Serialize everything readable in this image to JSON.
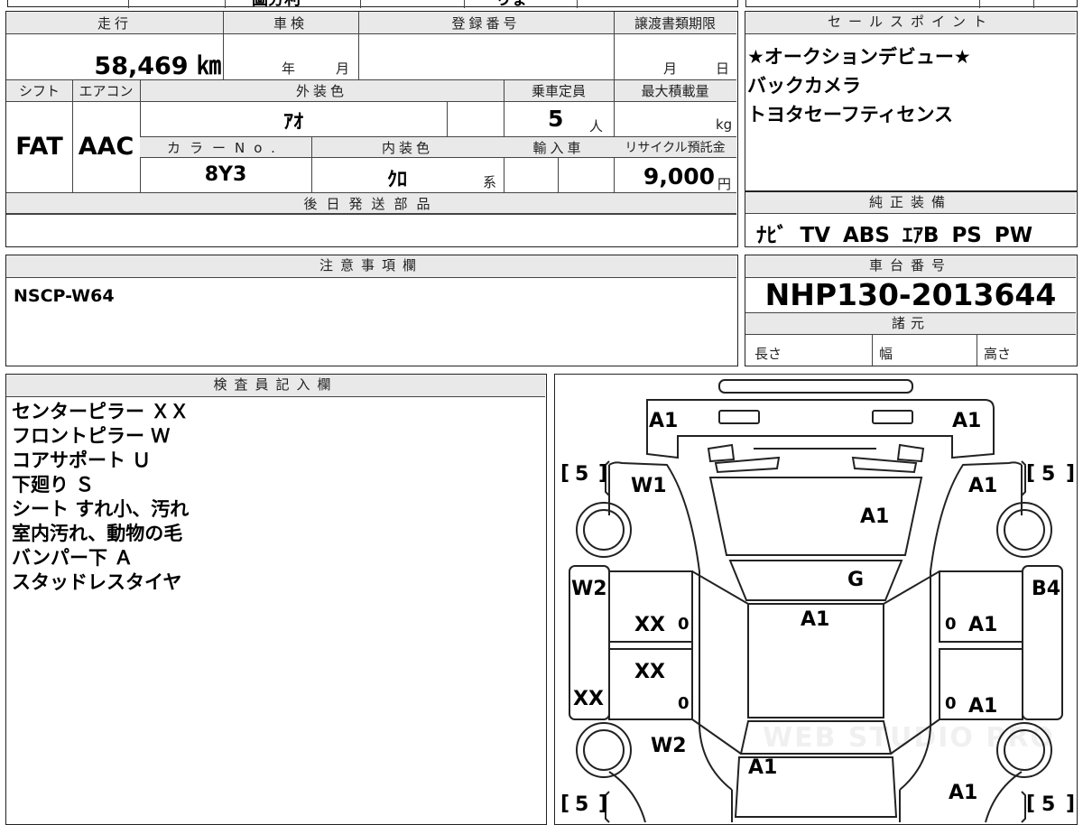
{
  "top_strip": {
    "v1": "圖分利",
    "v2": "りょ"
  },
  "main_info": {
    "mileage_label": "走行",
    "mileage_value": "58,469 ㎞",
    "inspection_label": "車検",
    "inspection_year_unit": "年",
    "inspection_month_unit": "月",
    "registration_label": "登録番号",
    "registration_value": "",
    "transfer_deadline_label": "譲渡書類期限",
    "transfer_month_unit": "月",
    "transfer_day_unit": "日",
    "shift_label": "シフト",
    "shift_value": "FAT",
    "aircon_label": "エアコン",
    "aircon_value": "AAC",
    "exterior_color_label": "外装色",
    "exterior_color_value": "ｱｵ",
    "capacity_label": "乗車定員",
    "capacity_value": "5",
    "capacity_unit": "人",
    "max_load_label": "最大積載量",
    "max_load_unit": "kg",
    "color_no_label": "カラーNo.",
    "color_no_value": "8Y3",
    "interior_color_label": "内装色",
    "interior_color_value": "ｸﾛ",
    "interior_color_suffix": "系",
    "import_label": "輸入車",
    "recycle_label": "リサイクル預託金",
    "recycle_value": "9,000",
    "recycle_unit": "円",
    "later_parts_label": "後日発送部品"
  },
  "sales_points": {
    "label": "セールスポイント",
    "lines": [
      "★オークションデビュー★",
      "バックカメラ",
      "トヨタセーフティセンス"
    ]
  },
  "genuine_equipment": {
    "label": "純正装備",
    "value": "ﾅﾋﾞ TV ABS ｴｱB PS PW"
  },
  "caution": {
    "label": "注意事項欄",
    "value": "NSCP-W64"
  },
  "chassis": {
    "label": "車台番号",
    "value": "NHP130-2013644",
    "specs_label": "諸元",
    "length_label": "長さ",
    "width_label": "幅",
    "height_label": "高さ"
  },
  "inspector": {
    "label": "検査員記入欄",
    "notes": [
      "センターピラー ＸＸ",
      "フロントピラー Ｗ",
      "コアサポート Ｕ",
      "下廻り Ｓ",
      "シート すれ小、汚れ",
      "室内汚れ、動物の毛",
      "バンパー下 Ａ",
      "スタッドレスタイヤ"
    ]
  },
  "diagram": {
    "tire_fl": "5",
    "tire_fr": "5",
    "tire_rl": "5",
    "tire_rr": "5",
    "front_left": "A1",
    "front_right": "A1",
    "fender_fl": "W1",
    "fender_fr": "A1",
    "hood": "A1",
    "windshield": "G",
    "roof": "A1",
    "left_front_pillar": "W2",
    "right_front_pillar": "B4",
    "left_front_door": "XX",
    "left_front_door_mark": "0",
    "left_rear_door": "XX",
    "left_rear_door_mark": "0",
    "left_sill": "XX",
    "right_front_door": "A1",
    "right_front_door_mark": "0",
    "right_rear_door": "A1",
    "right_rear_door_mark": "0",
    "rear_quarter_left": "W2",
    "trunk": "A1",
    "rear_right": "A1",
    "watermark": "WEB STUDIO PRO"
  }
}
